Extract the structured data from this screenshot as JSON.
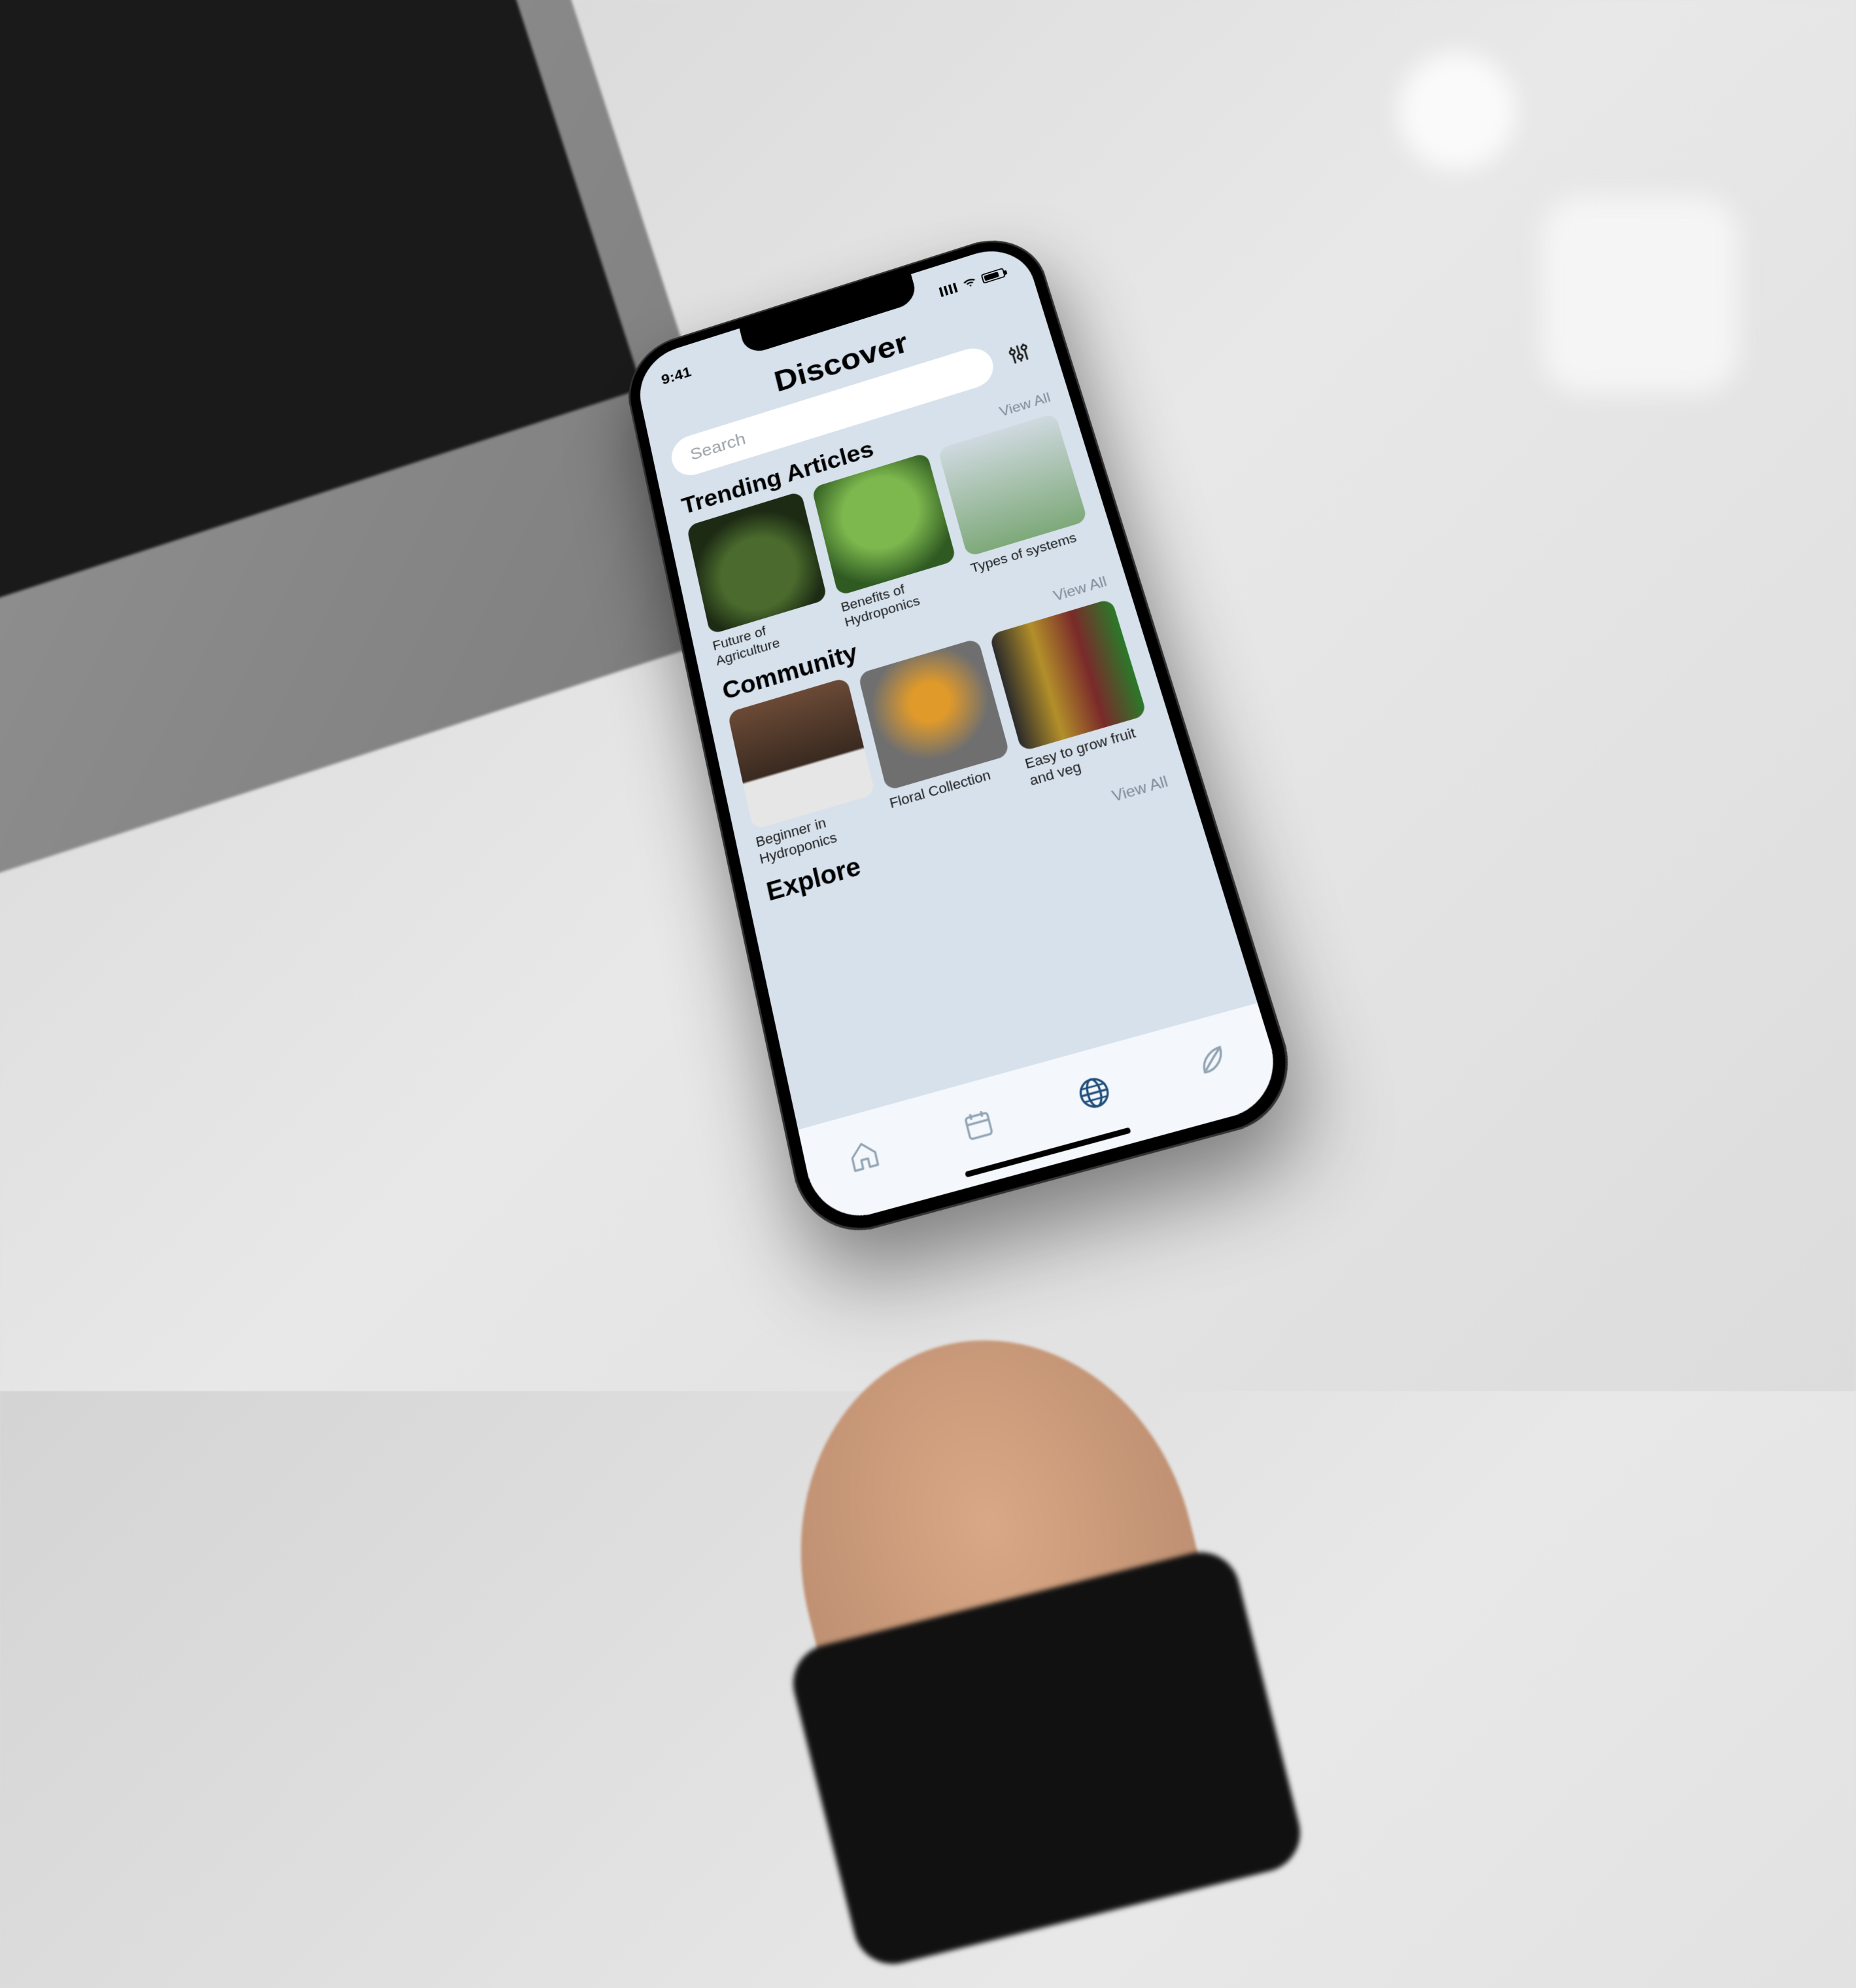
{
  "statusbar": {
    "time": "9:41"
  },
  "page": {
    "title": "Discover"
  },
  "search": {
    "placeholder": "Search"
  },
  "sections": {
    "trending": {
      "title": "Trending Articles",
      "view_all": "View All",
      "items": [
        {
          "label": "Future of Agriculture"
        },
        {
          "label": "Benefits of Hydroponics"
        },
        {
          "label": "Types of systems"
        }
      ]
    },
    "community": {
      "title": "Community",
      "view_all": "View All",
      "items": [
        {
          "label": "Beginner in Hydroponics"
        },
        {
          "label": "Floral Collection"
        },
        {
          "label": "Easy to grow fruit and veg"
        }
      ]
    },
    "explore": {
      "title": "Explore",
      "view_all": "View All"
    }
  },
  "tabs": {
    "home": "home-icon",
    "calendar": "calendar-icon",
    "discover": "globe-icon",
    "plants": "leaf-icon"
  }
}
